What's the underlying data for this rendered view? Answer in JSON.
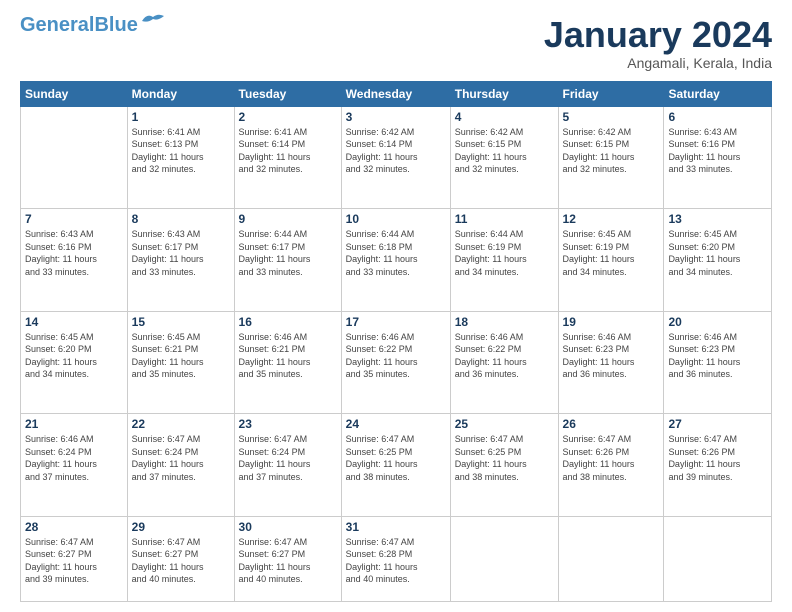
{
  "logo": {
    "line1": "General",
    "line2": "Blue"
  },
  "title": "January 2024",
  "location": "Angamali, Kerala, India",
  "days_header": [
    "Sunday",
    "Monday",
    "Tuesday",
    "Wednesday",
    "Thursday",
    "Friday",
    "Saturday"
  ],
  "weeks": [
    [
      {
        "day": "",
        "info": ""
      },
      {
        "day": "1",
        "info": "Sunrise: 6:41 AM\nSunset: 6:13 PM\nDaylight: 11 hours\nand 32 minutes."
      },
      {
        "day": "2",
        "info": "Sunrise: 6:41 AM\nSunset: 6:14 PM\nDaylight: 11 hours\nand 32 minutes."
      },
      {
        "day": "3",
        "info": "Sunrise: 6:42 AM\nSunset: 6:14 PM\nDaylight: 11 hours\nand 32 minutes."
      },
      {
        "day": "4",
        "info": "Sunrise: 6:42 AM\nSunset: 6:15 PM\nDaylight: 11 hours\nand 32 minutes."
      },
      {
        "day": "5",
        "info": "Sunrise: 6:42 AM\nSunset: 6:15 PM\nDaylight: 11 hours\nand 32 minutes."
      },
      {
        "day": "6",
        "info": "Sunrise: 6:43 AM\nSunset: 6:16 PM\nDaylight: 11 hours\nand 33 minutes."
      }
    ],
    [
      {
        "day": "7",
        "info": "Sunrise: 6:43 AM\nSunset: 6:16 PM\nDaylight: 11 hours\nand 33 minutes."
      },
      {
        "day": "8",
        "info": "Sunrise: 6:43 AM\nSunset: 6:17 PM\nDaylight: 11 hours\nand 33 minutes."
      },
      {
        "day": "9",
        "info": "Sunrise: 6:44 AM\nSunset: 6:17 PM\nDaylight: 11 hours\nand 33 minutes."
      },
      {
        "day": "10",
        "info": "Sunrise: 6:44 AM\nSunset: 6:18 PM\nDaylight: 11 hours\nand 33 minutes."
      },
      {
        "day": "11",
        "info": "Sunrise: 6:44 AM\nSunset: 6:19 PM\nDaylight: 11 hours\nand 34 minutes."
      },
      {
        "day": "12",
        "info": "Sunrise: 6:45 AM\nSunset: 6:19 PM\nDaylight: 11 hours\nand 34 minutes."
      },
      {
        "day": "13",
        "info": "Sunrise: 6:45 AM\nSunset: 6:20 PM\nDaylight: 11 hours\nand 34 minutes."
      }
    ],
    [
      {
        "day": "14",
        "info": "Sunrise: 6:45 AM\nSunset: 6:20 PM\nDaylight: 11 hours\nand 34 minutes."
      },
      {
        "day": "15",
        "info": "Sunrise: 6:45 AM\nSunset: 6:21 PM\nDaylight: 11 hours\nand 35 minutes."
      },
      {
        "day": "16",
        "info": "Sunrise: 6:46 AM\nSunset: 6:21 PM\nDaylight: 11 hours\nand 35 minutes."
      },
      {
        "day": "17",
        "info": "Sunrise: 6:46 AM\nSunset: 6:22 PM\nDaylight: 11 hours\nand 35 minutes."
      },
      {
        "day": "18",
        "info": "Sunrise: 6:46 AM\nSunset: 6:22 PM\nDaylight: 11 hours\nand 36 minutes."
      },
      {
        "day": "19",
        "info": "Sunrise: 6:46 AM\nSunset: 6:23 PM\nDaylight: 11 hours\nand 36 minutes."
      },
      {
        "day": "20",
        "info": "Sunrise: 6:46 AM\nSunset: 6:23 PM\nDaylight: 11 hours\nand 36 minutes."
      }
    ],
    [
      {
        "day": "21",
        "info": "Sunrise: 6:46 AM\nSunset: 6:24 PM\nDaylight: 11 hours\nand 37 minutes."
      },
      {
        "day": "22",
        "info": "Sunrise: 6:47 AM\nSunset: 6:24 PM\nDaylight: 11 hours\nand 37 minutes."
      },
      {
        "day": "23",
        "info": "Sunrise: 6:47 AM\nSunset: 6:24 PM\nDaylight: 11 hours\nand 37 minutes."
      },
      {
        "day": "24",
        "info": "Sunrise: 6:47 AM\nSunset: 6:25 PM\nDaylight: 11 hours\nand 38 minutes."
      },
      {
        "day": "25",
        "info": "Sunrise: 6:47 AM\nSunset: 6:25 PM\nDaylight: 11 hours\nand 38 minutes."
      },
      {
        "day": "26",
        "info": "Sunrise: 6:47 AM\nSunset: 6:26 PM\nDaylight: 11 hours\nand 38 minutes."
      },
      {
        "day": "27",
        "info": "Sunrise: 6:47 AM\nSunset: 6:26 PM\nDaylight: 11 hours\nand 39 minutes."
      }
    ],
    [
      {
        "day": "28",
        "info": "Sunrise: 6:47 AM\nSunset: 6:27 PM\nDaylight: 11 hours\nand 39 minutes."
      },
      {
        "day": "29",
        "info": "Sunrise: 6:47 AM\nSunset: 6:27 PM\nDaylight: 11 hours\nand 40 minutes."
      },
      {
        "day": "30",
        "info": "Sunrise: 6:47 AM\nSunset: 6:27 PM\nDaylight: 11 hours\nand 40 minutes."
      },
      {
        "day": "31",
        "info": "Sunrise: 6:47 AM\nSunset: 6:28 PM\nDaylight: 11 hours\nand 40 minutes."
      },
      {
        "day": "",
        "info": ""
      },
      {
        "day": "",
        "info": ""
      },
      {
        "day": "",
        "info": ""
      }
    ]
  ]
}
